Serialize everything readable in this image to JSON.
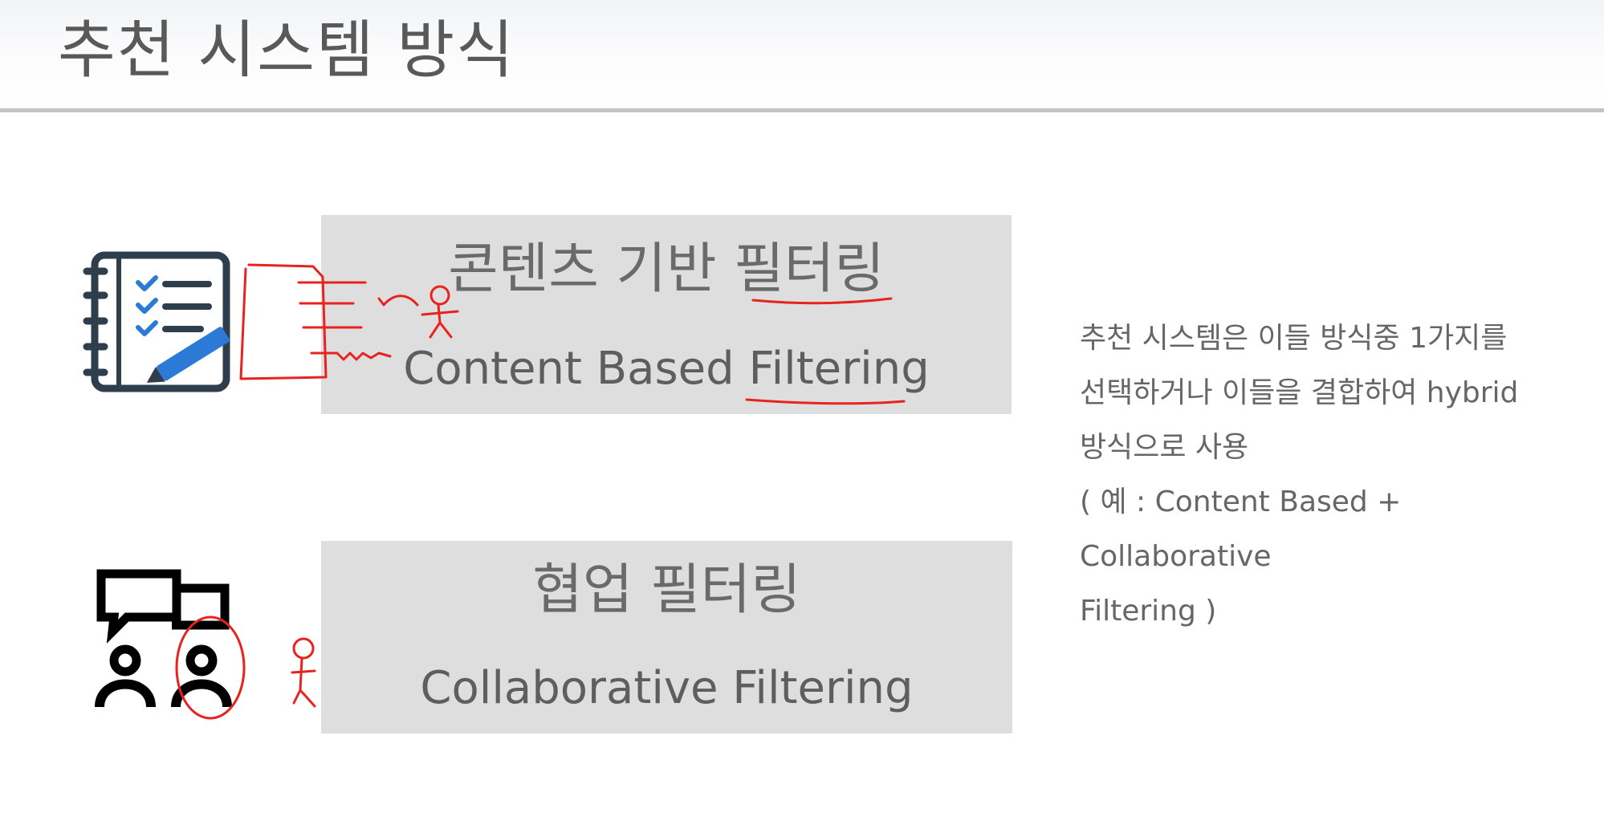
{
  "slide": {
    "title": "추천 시스템 방식"
  },
  "methods": [
    {
      "name_ko": "콘텐츠 기반 필터링",
      "name_en": "Content Based Filtering",
      "icon": "checklist-notebook-icon"
    },
    {
      "name_ko": "협업 필터링",
      "name_en": "Collaborative Filtering",
      "icon": "users-chat-icon"
    }
  ],
  "description": {
    "lines": [
      "추천 시스템은 이들 방식중 1가지를",
      "선택하거나 이들을 결합하여 hybrid",
      "방식으로 사용",
      "( 예 : Content Based + Collaborative",
      "Filtering )"
    ]
  },
  "colors": {
    "panel_bg": "#dedede",
    "ink_red": "#e8231f",
    "icon_dark": "#2f3e4c",
    "icon_blue": "#2b7bd6"
  }
}
